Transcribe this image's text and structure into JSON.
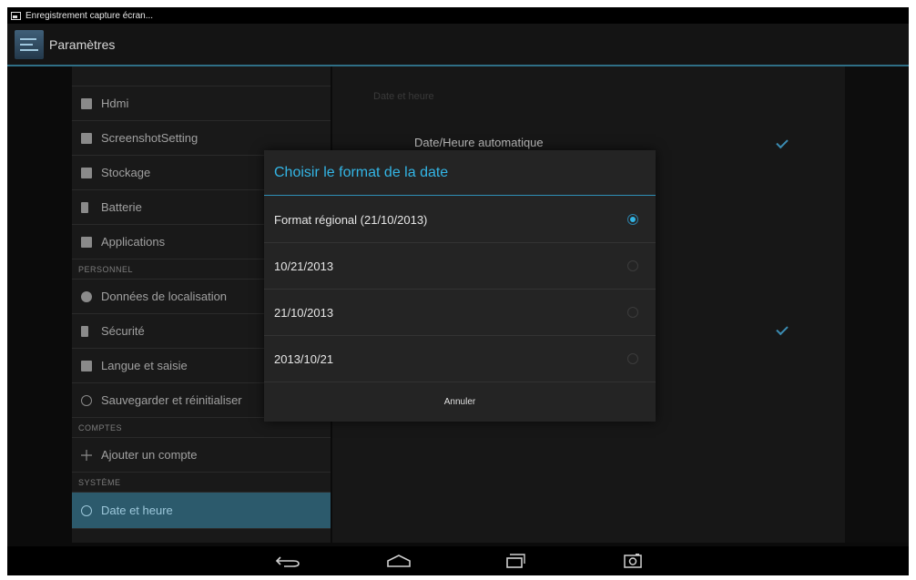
{
  "status_bar": {
    "notification": "Enregistrement capture écran..."
  },
  "action_bar": {
    "title": "Paramètres"
  },
  "sidebar": {
    "items_top": [
      {
        "label": "Hdmi",
        "icon": "display-icon"
      },
      {
        "label": "ScreenshotSetting",
        "icon": "camera-icon"
      },
      {
        "label": "Stockage",
        "icon": "storage-icon"
      },
      {
        "label": "Batterie",
        "icon": "battery-icon"
      },
      {
        "label": "Applications",
        "icon": "apps-icon"
      }
    ],
    "header_personal": "PERSONNEL",
    "items_personal": [
      {
        "label": "Données de localisation",
        "icon": "location-icon"
      },
      {
        "label": "Sécurité",
        "icon": "lock-icon"
      },
      {
        "label": "Langue et saisie",
        "icon": "keyboard-icon"
      },
      {
        "label": "Sauvegarder et réinitialiser",
        "icon": "backup-icon"
      }
    ],
    "header_accounts": "COMPTES",
    "add_account": "Ajouter un compte",
    "header_system": "SYSTÈME",
    "selected_item": "Date et heure"
  },
  "detail": {
    "category": "Date et heure",
    "auto_label": "Date/Heure automatique"
  },
  "dialog": {
    "title": "Choisir le format de la date",
    "options": [
      {
        "label": "Format régional (21/10/2013)",
        "selected": true
      },
      {
        "label": "10/21/2013",
        "selected": false
      },
      {
        "label": "21/10/2013",
        "selected": false
      },
      {
        "label": "2013/10/21",
        "selected": false
      }
    ],
    "cancel_label": "Annuler"
  },
  "colors": {
    "accent": "#33b5e5",
    "selected_bg": "#2c5a6c"
  }
}
